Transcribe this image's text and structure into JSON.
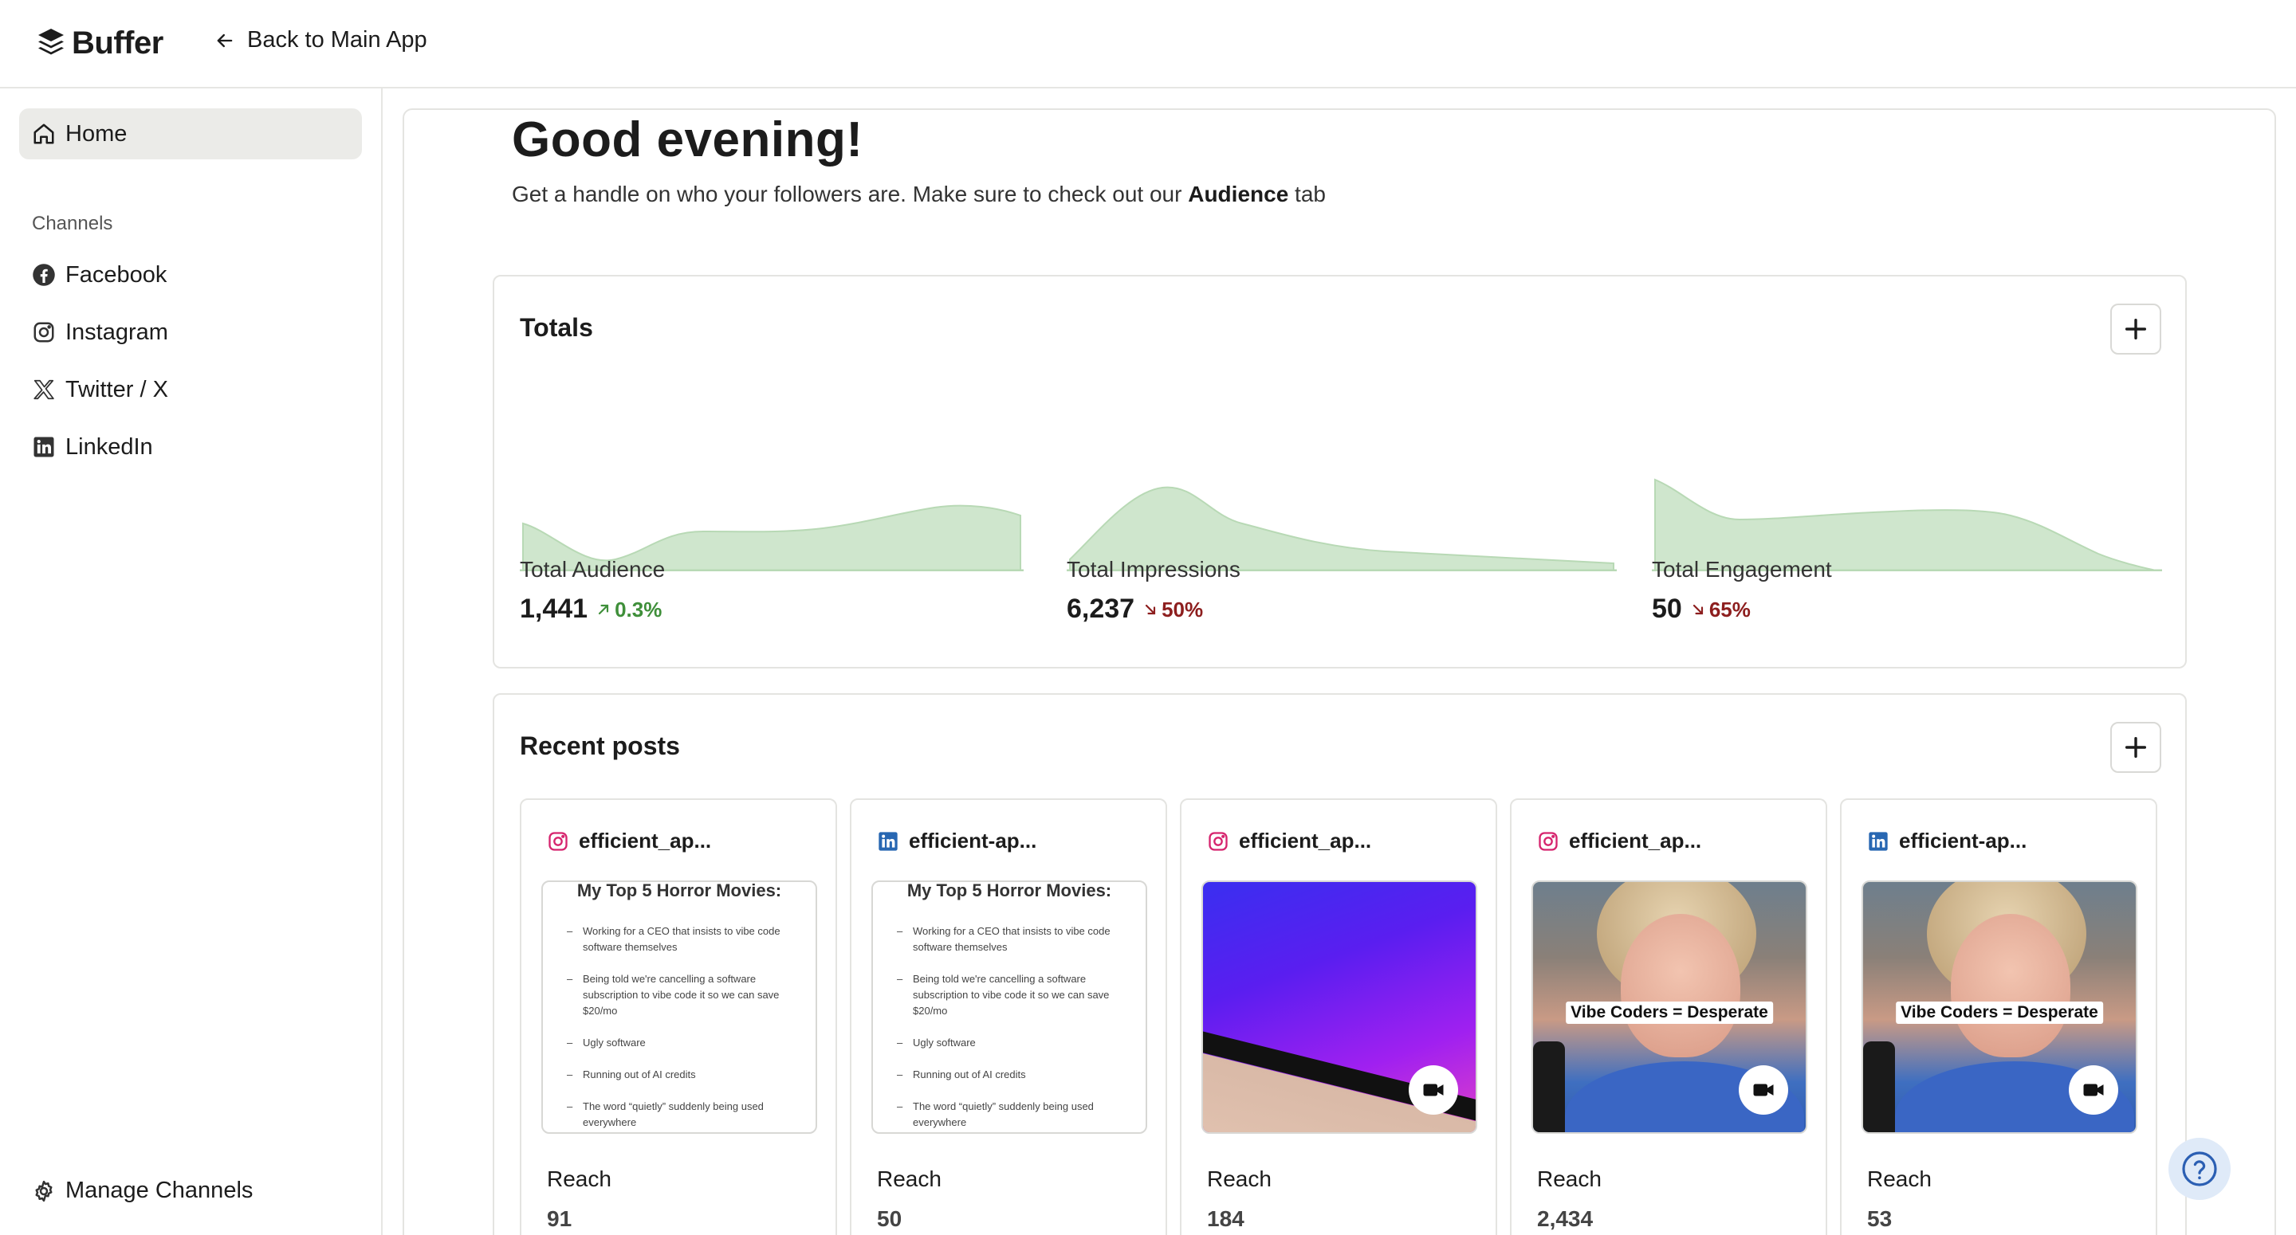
{
  "header": {
    "brand": "Buffer",
    "back_label": "Back to Main App"
  },
  "sidebar": {
    "home_label": "Home",
    "channels_heading": "Channels",
    "channels": [
      {
        "label": "Facebook",
        "icon": "facebook-icon"
      },
      {
        "label": "Instagram",
        "icon": "instagram-icon"
      },
      {
        "label": "Twitter / X",
        "icon": "x-icon"
      },
      {
        "label": "LinkedIn",
        "icon": "linkedin-icon"
      }
    ],
    "manage_label": "Manage Channels"
  },
  "main": {
    "greeting": "Good evening!",
    "subline_prefix": "Get a handle on who your followers are. Make sure to check out our",
    "subline_bold": "Audience",
    "subline_suffix": "tab"
  },
  "totals": {
    "title": "Totals",
    "metrics": [
      {
        "label": "Total Audience",
        "value": "1,441",
        "change": "0.3%",
        "direction": "up"
      },
      {
        "label": "Total Impressions",
        "value": "6,237",
        "change": "50%",
        "direction": "down"
      },
      {
        "label": "Total Engagement",
        "value": "50",
        "change": "65%",
        "direction": "down"
      }
    ]
  },
  "recent_posts": {
    "title": "Recent posts",
    "reach_label": "Reach",
    "posts": [
      {
        "network": "instagram",
        "account": "efficient_ap...",
        "reach": "91"
      },
      {
        "network": "linkedin",
        "account": "efficient-ap...",
        "reach": "50"
      },
      {
        "network": "instagram",
        "account": "efficient_ap...",
        "reach": "184"
      },
      {
        "network": "instagram",
        "account": "efficient_ap...",
        "reach": "2,434"
      },
      {
        "network": "linkedin",
        "account": "efficient-ap...",
        "reach": "53"
      }
    ],
    "doc_thumbnail": {
      "title": "My Top 5 Horror Movies:",
      "items": [
        "Working for a CEO that insists to vibe code software themselves",
        "Being told we're cancelling a software subscription to vibe code it so we can save $20/mo",
        "Ugly software",
        "Running out of AI credits",
        "The word “quietly” suddenly being used everywhere"
      ]
    },
    "video_caption": "Vibe Coders = Desperate"
  },
  "colors": {
    "accent_green_fill": "#cfe6cd",
    "accent_green_line": "#b3d6b0",
    "up": "#3f8f3a",
    "down": "#8d1e1e",
    "instagram": "#d6246e",
    "linkedin": "#2867b2"
  }
}
